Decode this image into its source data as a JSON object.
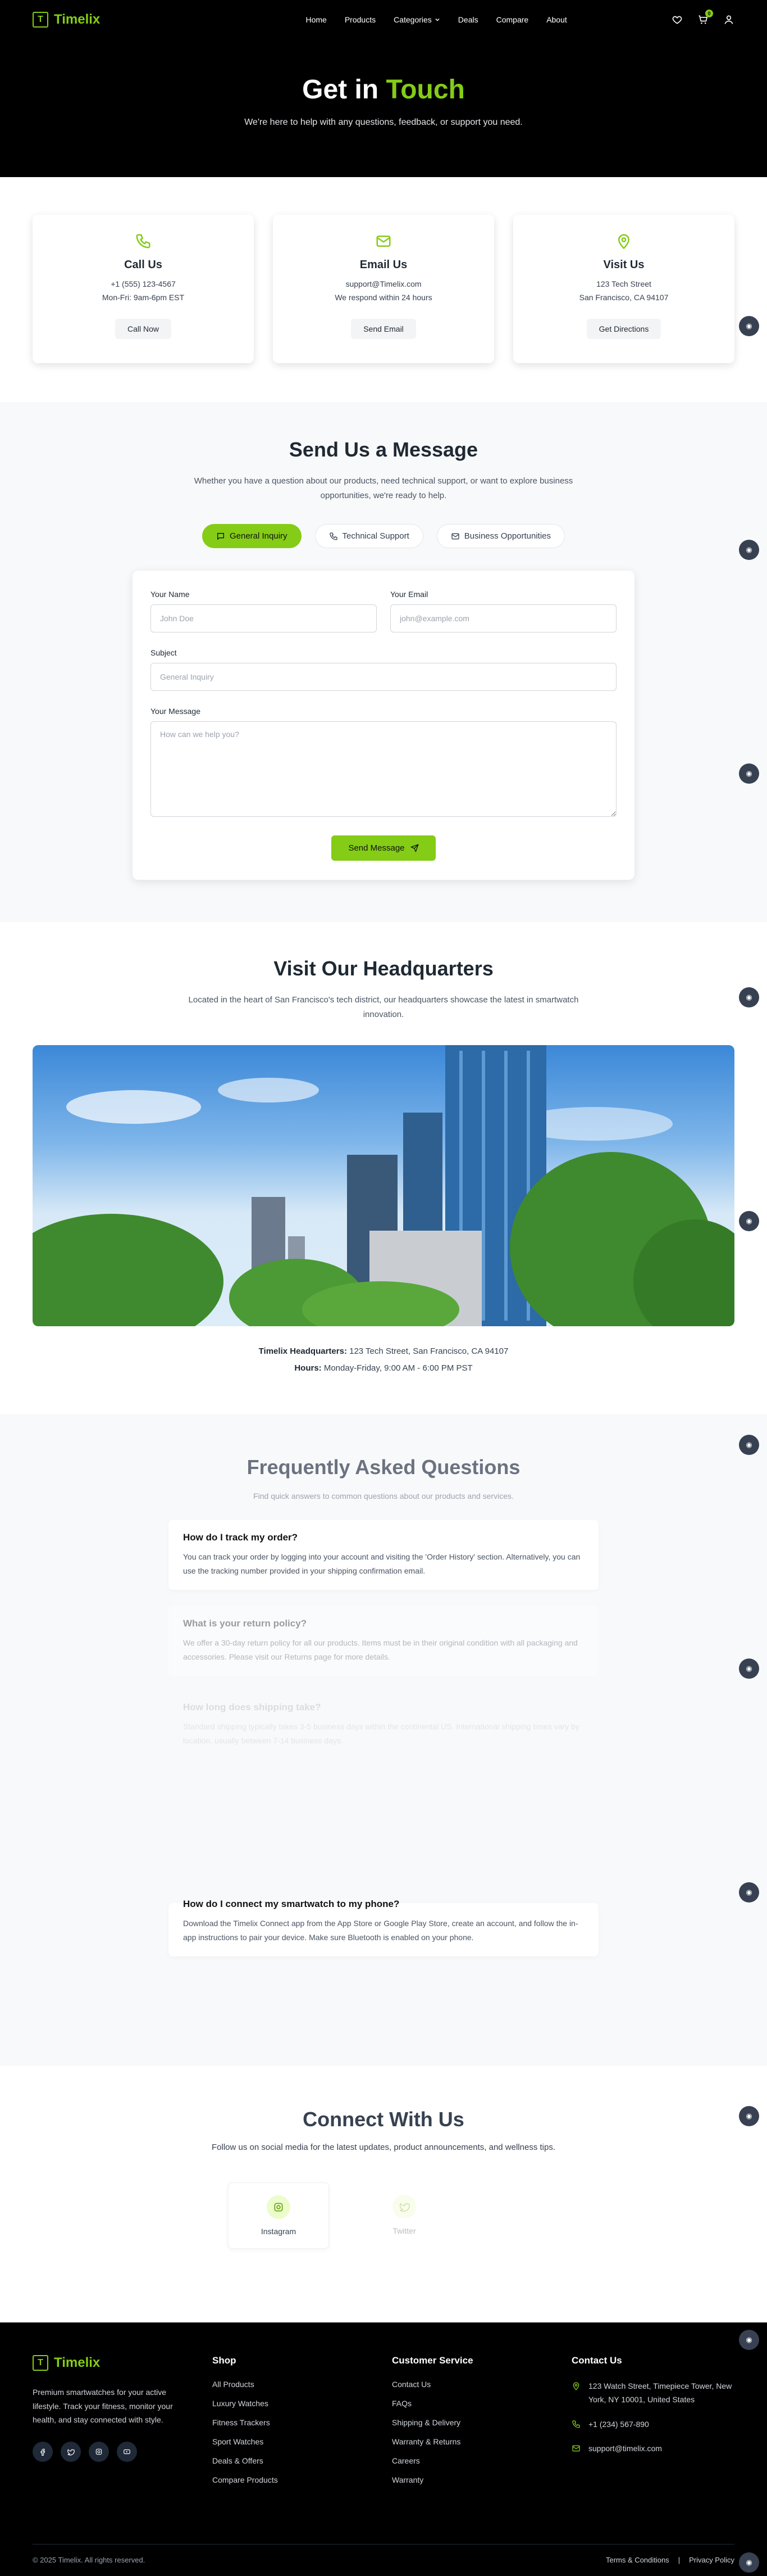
{
  "brand": {
    "name": "Timelix",
    "letter": "T"
  },
  "nav": {
    "items": [
      "Home",
      "Products",
      "Categories",
      "Deals",
      "Compare",
      "About"
    ],
    "cart_count": "0"
  },
  "hero": {
    "title_main": "Get in",
    "title_accent": "Touch",
    "subtitle": "We're here to help with any questions, feedback, or support you need."
  },
  "contact_cards": [
    {
      "icon": "phone-icon",
      "title": "Call Us",
      "line1": "+1 (555) 123-4567",
      "line2": "Mon-Fri: 9am-6pm EST",
      "button": "Call Now"
    },
    {
      "icon": "mail-icon",
      "title": "Email Us",
      "line1": "support@Timelix.com",
      "line2": "We respond within 24 hours",
      "button": "Send Email"
    },
    {
      "icon": "map-pin-icon",
      "title": "Visit Us",
      "line1": "123 Tech Street",
      "line2": "San Francisco, CA 94107",
      "button": "Get Directions"
    }
  ],
  "message": {
    "title": "Send Us a Message",
    "subtitle": "Whether you have a question about our products, need technical support, or want to explore business opportunities, we're ready to help.",
    "tabs": [
      "General Inquiry",
      "Technical Support",
      "Business Opportunities"
    ],
    "name_label": "Your Name",
    "name_placeholder": "John Doe",
    "email_label": "Your Email",
    "email_placeholder": "john@example.com",
    "subject_label": "Subject",
    "subject_placeholder": "General Inquiry",
    "message_label": "Your Message",
    "message_placeholder": "How can we help you?",
    "send_label": "Send Message"
  },
  "hq": {
    "title": "Visit Our Headquarters",
    "subtitle": "Located in the heart of San Francisco's tech district, our headquarters showcase the latest in smartwatch innovation.",
    "address_label": "Timelix Headquarters:",
    "address": "123 Tech Street, San Francisco, CA 94107",
    "hours_label": "Hours:",
    "hours": "Monday-Friday, 9:00 AM - 6:00 PM PST"
  },
  "faq": {
    "title": "Frequently Asked Questions",
    "subtitle": "Find quick answers to common questions about our products and services.",
    "items": [
      {
        "q": "How do I track my order?",
        "a": "You can track your order by logging into your account and visiting the 'Order History' section. Alternatively, you can use the tracking number provided in your shipping confirmation email."
      },
      {
        "q": "What is your return policy?",
        "a": "We offer a 30-day return policy for all our products. Items must be in their original condition with all packaging and accessories. Please visit our Returns page for more details."
      },
      {
        "q": "How long does shipping take?",
        "a": "Standard shipping typically takes 3-5 business days within the continental US. International shipping times vary by location, usually between 7-14 business days."
      },
      {
        "q": "How do I connect my smartwatch to my phone?",
        "a": "Download the Timelix Connect app from the App Store or Google Play Store, create an account, and follow the in-app instructions to pair your device. Make sure Bluetooth is enabled on your phone."
      }
    ]
  },
  "social": {
    "title": "Connect With Us",
    "subtitle": "Follow us on social media for the latest updates, product announcements, and wellness tips.",
    "items": [
      "Instagram",
      "Twitter"
    ]
  },
  "footer": {
    "description": "Premium smartwatches for your active lifestyle. Track your fitness, monitor your health, and stay connected with style.",
    "shop_title": "Shop",
    "shop_links": [
      "All Products",
      "Luxury Watches",
      "Fitness Trackers",
      "Sport Watches",
      "Deals & Offers",
      "Compare Products"
    ],
    "service_title": "Customer Service",
    "service_links": [
      "Contact Us",
      "FAQs",
      "Shipping & Delivery",
      "Warranty & Returns",
      "Careers",
      "Warranty"
    ],
    "contact_title": "Contact Us",
    "address": "123 Watch Street, Timepiece Tower, New York, NY 10001, United States",
    "phone": "+1 (234) 567-890",
    "email": "support@timelix.com",
    "copyright": "© 2025 Timelix. All rights reserved.",
    "terms": "Terms & Conditions",
    "sep": "|",
    "privacy": "Privacy Policy"
  },
  "colors": {
    "accent": "#84cc16",
    "dark": "#000000",
    "muted": "#f8f9fb"
  },
  "fab_icon": "chat-bot-icon"
}
